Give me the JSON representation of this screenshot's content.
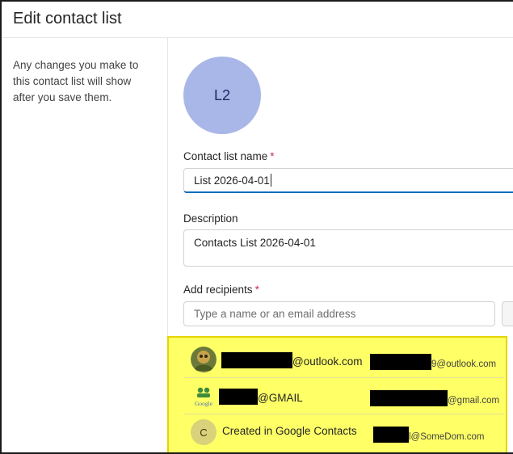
{
  "page": {
    "title": "Edit contact list",
    "help_text": "Any changes you make to this contact list will show after you save them."
  },
  "avatar": {
    "initials": "L2"
  },
  "form": {
    "name_label": "Contact list name",
    "name_required": "*",
    "name_value": "List 2026-04-01",
    "description_label": "Description",
    "description_value": "Contacts List 2026-04-01",
    "recipients_label": "Add recipients",
    "recipients_required": "*",
    "recipients_placeholder": "Type a name or an email address"
  },
  "recipients": [
    {
      "avatar": "photo-avatar",
      "display_name": "@outlook.com",
      "email": "9@outlook.com"
    },
    {
      "avatar": "google-logo",
      "display_name": "@GMAIL",
      "email": "@gmail.com"
    },
    {
      "avatar_initial": "C",
      "display_name": "Created in Google Contacts",
      "email": "l@SomeDom.com"
    }
  ],
  "colors": {
    "highlight": "#ffff66",
    "avatar_large": "#a9b7e8",
    "accent": "#0f6cbd"
  }
}
